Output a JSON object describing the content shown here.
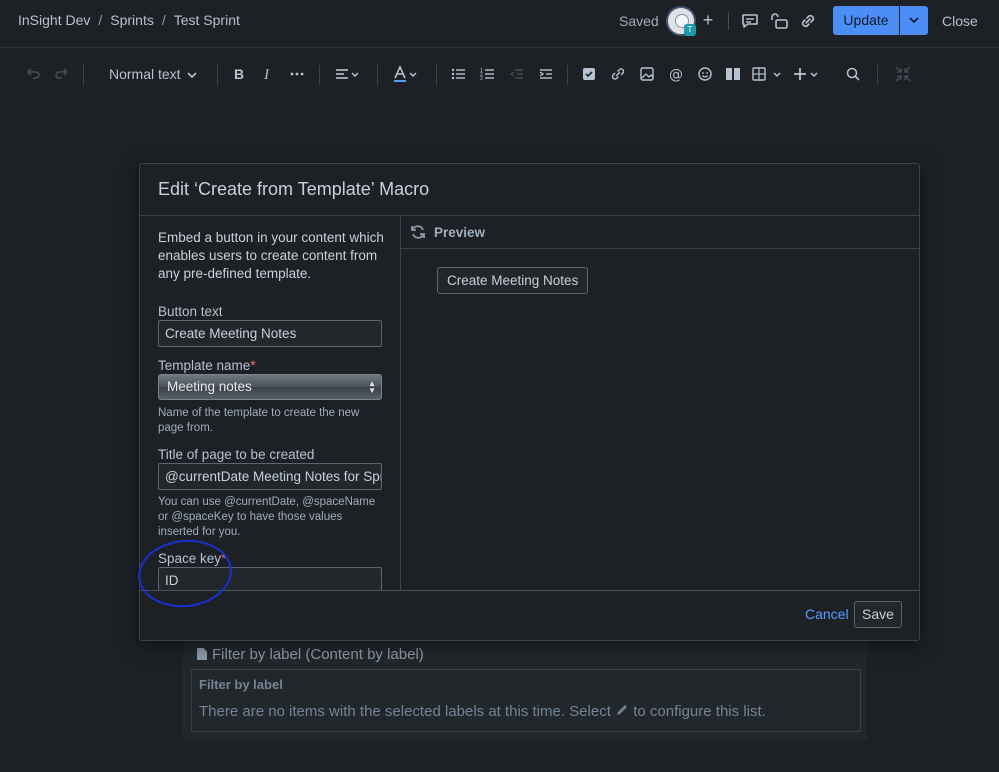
{
  "breadcrumb": [
    "InSight Dev",
    "Sprints",
    "Test Sprint"
  ],
  "header": {
    "status": "Saved",
    "avatar_badge": "T",
    "update_label": "Update",
    "close_label": "Close"
  },
  "toolbar": {
    "text_style": "Normal text"
  },
  "background": {
    "macro_title": "Filter by label (Content by label)",
    "inner_label": "Filter by label",
    "message": "There are no items with the selected labels at this time. Select",
    "message_end": "to configure this list."
  },
  "dialog": {
    "title": "Edit ‘Create from Template’ Macro",
    "description": "Embed a button in your content which enables users to create content from any pre-defined template.",
    "fields": {
      "button_text": {
        "label": "Button text",
        "value": "Create Meeting Notes"
      },
      "template_name": {
        "label": "Template name",
        "required_mark": "*",
        "value": "Meeting notes",
        "help": "Name of the template to create the new page from."
      },
      "page_title": {
        "label": "Title of page to be created",
        "value": "@currentDate Meeting Notes for Spr",
        "help": "You can use @currentDate, @spaceName or @spaceKey to have those values inserted for you."
      },
      "space_key": {
        "label": "Space key",
        "required_mark": "*",
        "value": "ID"
      }
    },
    "preview": {
      "label": "Preview",
      "button_label": "Create Meeting Notes"
    },
    "footer": {
      "cancel_label": "Cancel",
      "save_label": "Save"
    }
  },
  "colors": {
    "background": "#1d2125",
    "accent": "#4c8ef5",
    "link": "#579dff",
    "annotation": "#1a2fd4"
  }
}
